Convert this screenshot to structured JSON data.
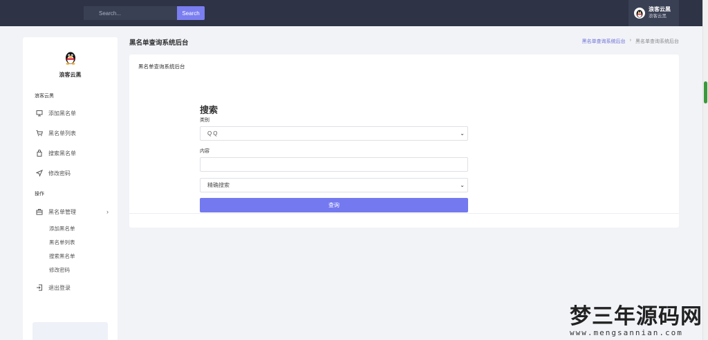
{
  "topbar": {
    "search_placeholder": "Search...",
    "search_button": "Search",
    "user_name": "浪客云黑",
    "user_role": "浪客云黑"
  },
  "sidebar": {
    "brand_name": "浪客云黑",
    "section_main": "浪客云黑",
    "items": [
      {
        "label": "添加黑名单",
        "icon": "monitor-icon"
      },
      {
        "label": "黑名单列表",
        "icon": "cart-icon"
      },
      {
        "label": "搜索黑名单",
        "icon": "bag-icon"
      },
      {
        "label": "修改密码",
        "icon": "send-icon"
      }
    ],
    "section_ops": "操作",
    "manage_label": "黑名单管理",
    "sub_items": [
      "添加黑名单",
      "黑名单列表",
      "搜索黑名单",
      "修改密码"
    ],
    "logout_label": "退出登录"
  },
  "header": {
    "page_title": "黑名单查询系统后台",
    "breadcrumb": [
      "黑名单查询系统后台",
      "黑名单查询系统后台"
    ]
  },
  "card": {
    "header": "黑名单查询系统后台"
  },
  "form": {
    "title": "搜索",
    "category_label": "类别",
    "category_value": "QQ",
    "content_label": "内容",
    "content_value": "",
    "mode_value": "精确搜索",
    "submit_label": "查询"
  },
  "watermark": {
    "main": "梦三年源码网",
    "sub": "www.mengsannian.com"
  },
  "colors": {
    "topbar": "#2e3346",
    "accent": "#7479f0",
    "background": "#f1f3f7"
  }
}
